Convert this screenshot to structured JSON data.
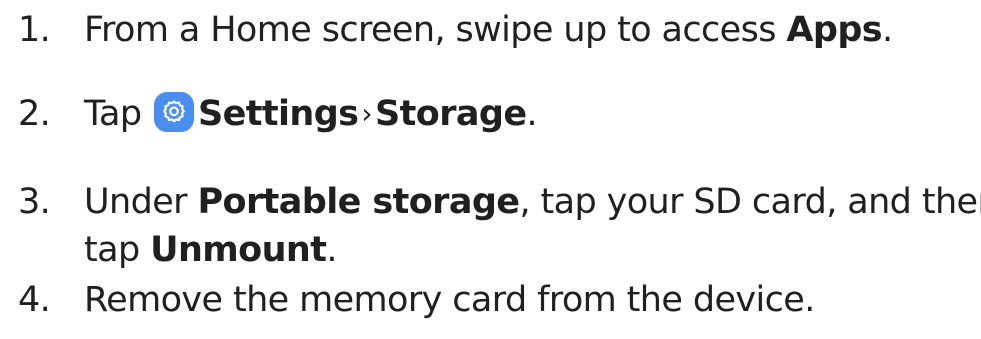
{
  "steps": [
    {
      "num": "1.",
      "pre": "From a Home screen, swipe up to access ",
      "bold": "Apps",
      "post": "."
    },
    {
      "num": "2.",
      "pre": "Tap ",
      "icon": "settings-gear-icon",
      "bold1": "Settings",
      "separator": "›",
      "bold2": "Storage",
      "post": "."
    },
    {
      "num": "3.",
      "pre": "Under ",
      "bold1": "Portable storage",
      "mid": ", tap your SD card, and then",
      "line2_pre": "tap ",
      "bold2": "Unmount",
      "post": "."
    },
    {
      "num": "4.",
      "text": "Remove the memory card from the device."
    }
  ],
  "colors": {
    "text": "#202020",
    "icon_bg": "#4a8ef0"
  }
}
